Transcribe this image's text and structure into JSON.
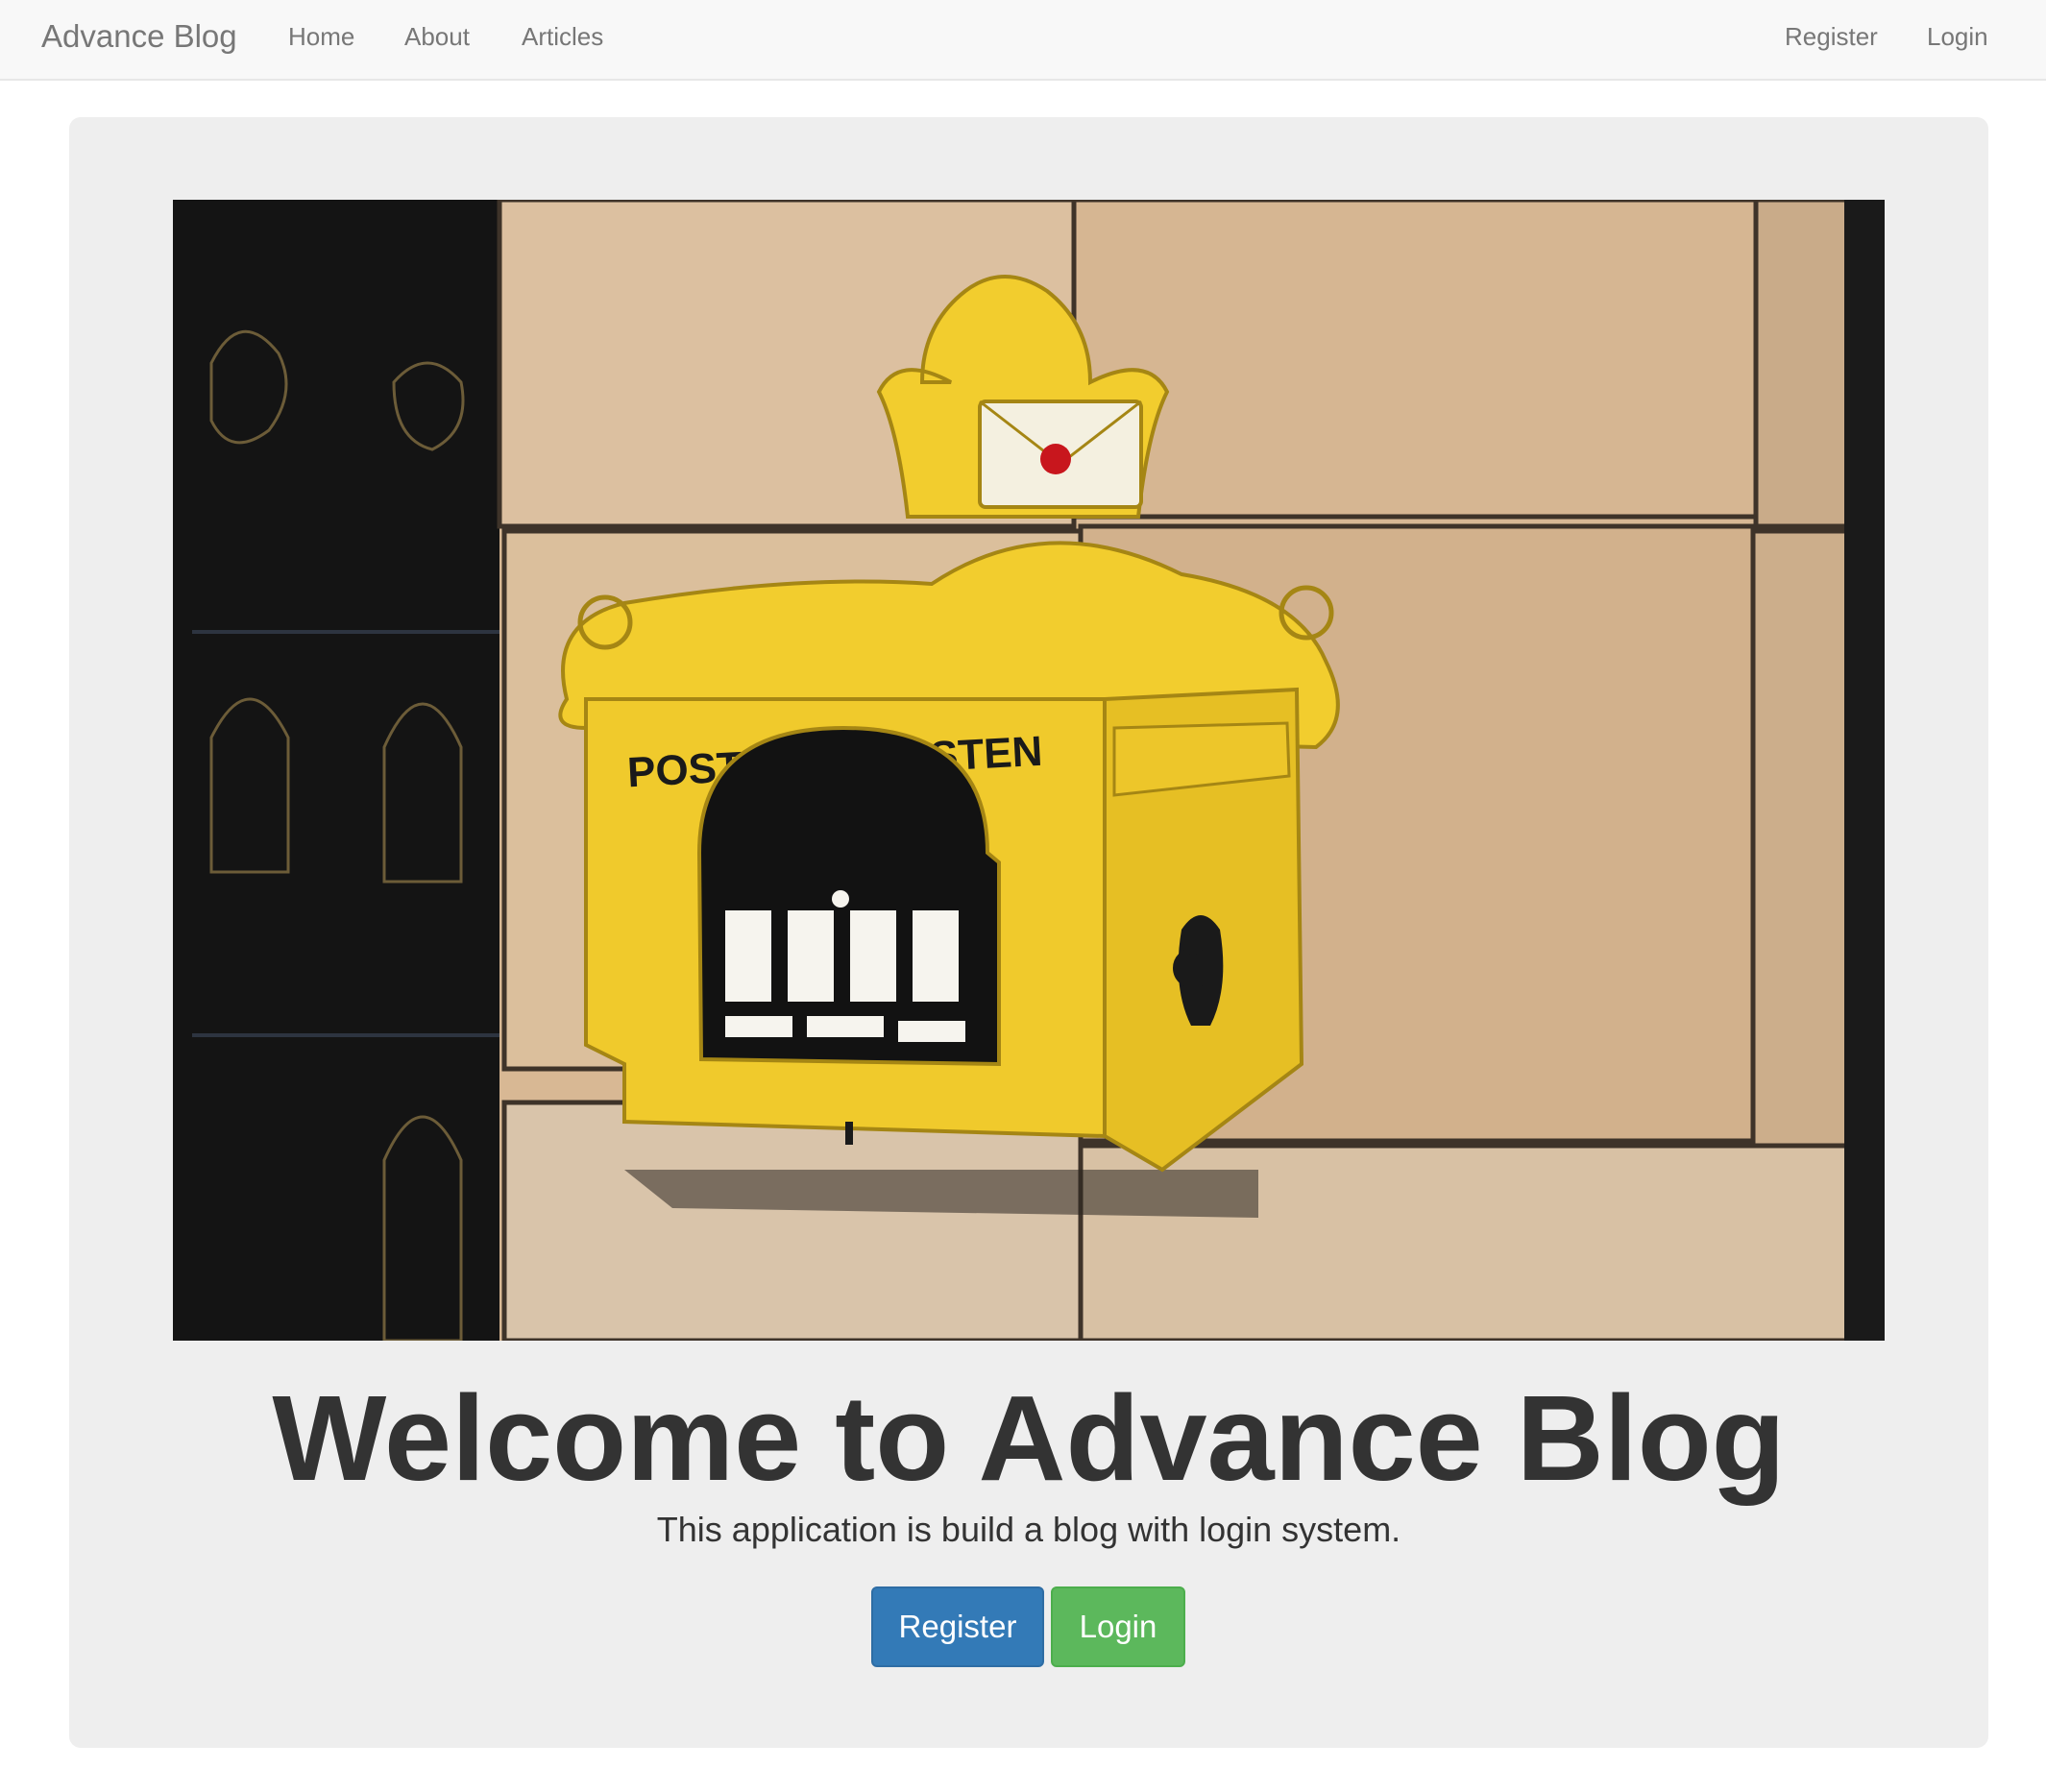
{
  "navbar": {
    "brand": "Advance Blog",
    "links": [
      {
        "label": "Home"
      },
      {
        "label": "About"
      },
      {
        "label": "Articles"
      }
    ],
    "right_links": [
      {
        "label": "Register"
      },
      {
        "label": "Login"
      }
    ]
  },
  "hero": {
    "image_text": "POSTBRIEFKASTEN",
    "title": "Welcome to Advance Blog",
    "subtitle": "This application is build a blog with login system.",
    "register_label": "Register",
    "login_label": "Login"
  },
  "colors": {
    "primary": "#337ab7",
    "success": "#5cb85c",
    "navbar_bg": "#f8f8f8",
    "jumbotron_bg": "#eeeeee",
    "mailbox_yellow": "#f2cd2e"
  }
}
